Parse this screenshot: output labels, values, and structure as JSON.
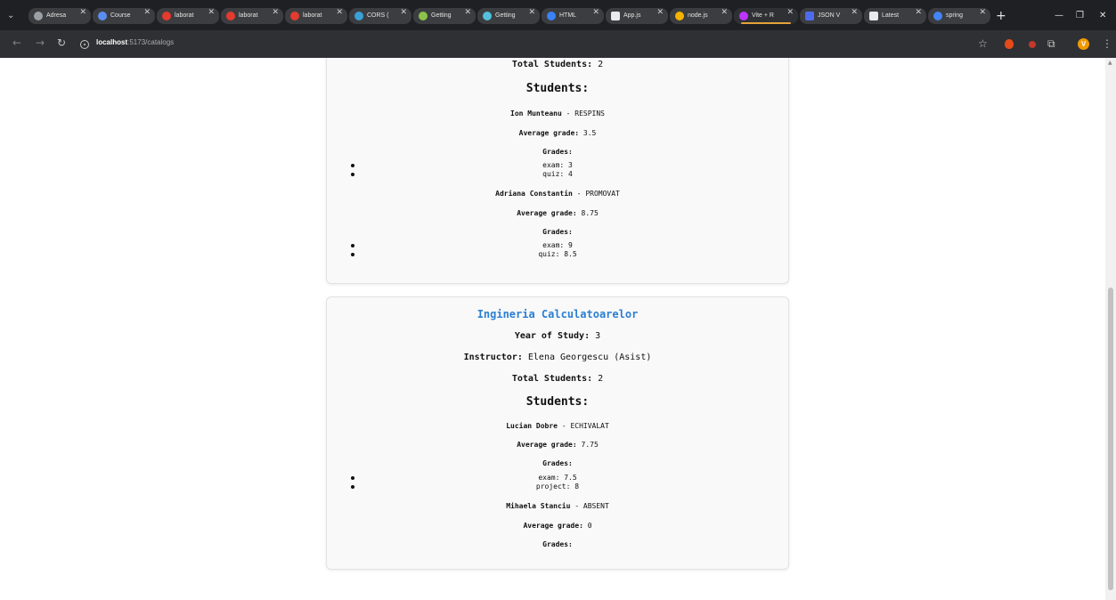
{
  "browser": {
    "tabs": [
      {
        "label": "Adresa",
        "color": "#9aa0a6"
      },
      {
        "label": "Course",
        "color": "#5b8def"
      },
      {
        "label": "laborat",
        "color": "#e33b2e"
      },
      {
        "label": "laborat",
        "color": "#e33b2e"
      },
      {
        "label": "laborat",
        "color": "#e33b2e"
      },
      {
        "label": "CORS (",
        "color": "#3aa0d8"
      },
      {
        "label": "Getting",
        "color": "#8bc34a"
      },
      {
        "label": "Getting",
        "color": "#53c1de"
      },
      {
        "label": "HTML",
        "color": "#3b82f6"
      },
      {
        "label": "App.js",
        "color": "#e8eaed"
      },
      {
        "label": "node.js",
        "color": "#f4b400"
      },
      {
        "label": "Vite + R",
        "color": "#bd34fe",
        "active": true
      },
      {
        "label": "JSON V",
        "color": "#4f6bed"
      },
      {
        "label": "Latest",
        "color": "#e8eaed"
      },
      {
        "label": "spring",
        "color": "#4285f4"
      }
    ],
    "url_host": "localhost",
    "url_path": ":5173/catalogs",
    "profile_initial": "V"
  },
  "catalog1": {
    "total_students_label": "Total Students:",
    "total_students": "2",
    "students_heading": "Students:",
    "students": [
      {
        "name": "Ion Munteanu",
        "status": "RESPINS",
        "avg_label": "Average grade:",
        "avg": "3.5",
        "grades_label": "Grades:",
        "grades": [
          "exam: 3",
          "quiz: 4"
        ]
      },
      {
        "name": "Adriana Constantin",
        "status": "PROMOVAT",
        "avg_label": "Average grade:",
        "avg": "8.75",
        "grades_label": "Grades:",
        "grades": [
          "exam: 9",
          "quiz: 8.5"
        ]
      }
    ]
  },
  "catalog2": {
    "title": "Ingineria Calculatoarelor",
    "year_label": "Year of Study:",
    "year": "3",
    "instructor_label": "Instructor:",
    "instructor": "Elena Georgescu (Asist)",
    "total_students_label": "Total Students:",
    "total_students": "2",
    "students_heading": "Students:",
    "students": [
      {
        "name": "Lucian Dobre",
        "status": "ECHIVALAT",
        "avg_label": "Average grade:",
        "avg": "7.75",
        "grades_label": "Grades:",
        "grades": [
          "exam: 7.5",
          "project: 8"
        ]
      },
      {
        "name": "Mihaela Stanciu",
        "status": "ABSENT",
        "avg_label": "Average grade:",
        "avg": "0",
        "grades_label": "Grades:",
        "grades": []
      }
    ]
  }
}
